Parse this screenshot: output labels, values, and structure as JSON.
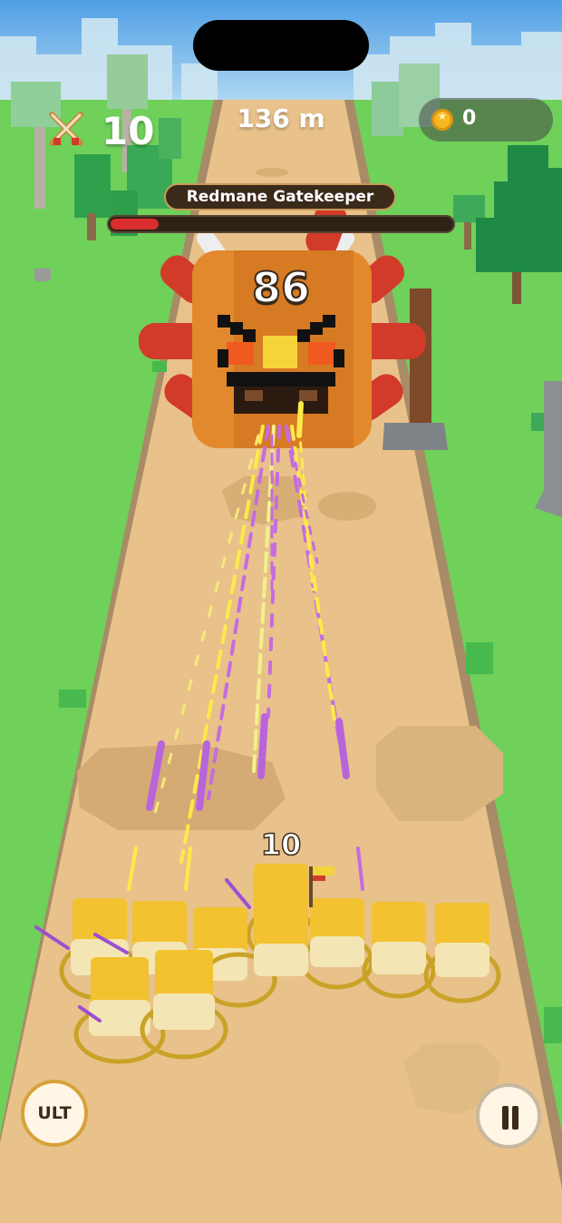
{
  "hud": {
    "unit_count": "10",
    "distance": "136 m",
    "coins": "0",
    "icons": {
      "units": "crossed-swords-icon",
      "coins": "coin-icon",
      "pause": "pause-icon"
    }
  },
  "boss": {
    "name": "Redmane Gatekeeper",
    "hp_number": "86",
    "hp_fraction": 0.14
  },
  "squad": {
    "count": "10"
  },
  "controls": {
    "ult_label": "ULT"
  },
  "colors": {
    "sky": "#5aa9e8",
    "grass": "#6fd05a",
    "road": "#e8c28a",
    "boss_body": "#e2892e",
    "boss_spikes": "#d23a2a",
    "unit_body": "#f2c230",
    "arrow_yellow": "#ffe94a",
    "arrow_purple": "#c56ce0",
    "hp_red": "#d82e2e"
  }
}
